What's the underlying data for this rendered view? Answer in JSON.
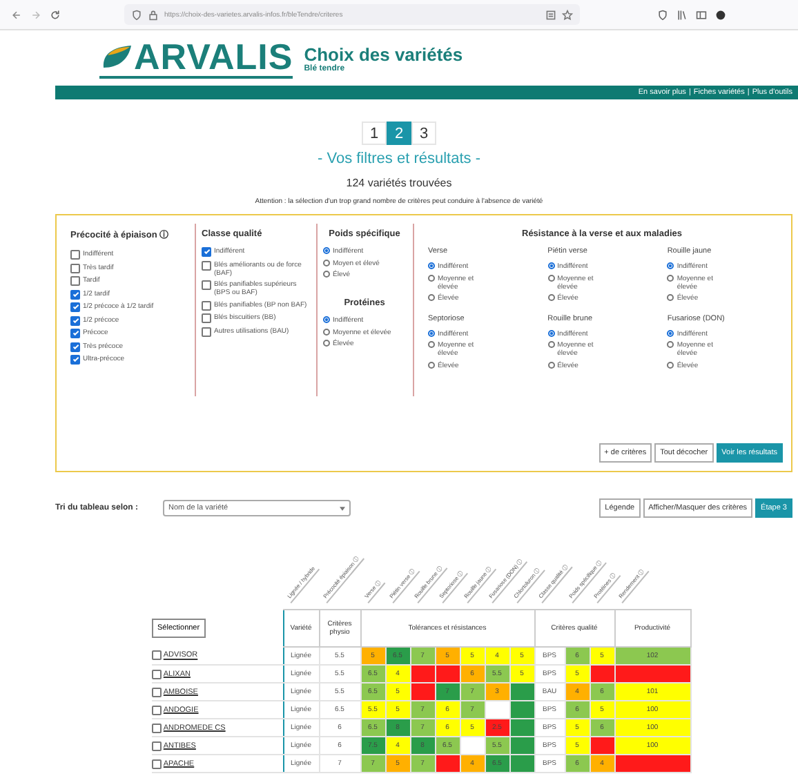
{
  "browser": {
    "url": "https://choix-des-varietes.arvalis-infos.fr/bleTendre/criteres"
  },
  "header": {
    "logo": "ARVALIS",
    "title": "Choix des variétés",
    "subtitle": "Blé tendre",
    "links": [
      "En savoir plus",
      "Fiches variétés",
      "Plus d'outils"
    ],
    "separator": "|"
  },
  "steps": [
    {
      "label": "1",
      "selected": false
    },
    {
      "label": "2",
      "selected": true
    },
    {
      "label": "3",
      "selected": false
    }
  ],
  "section_title": "- Vos filtres et résultats -",
  "count": "124 variétés trouvées",
  "warning": "Attention : la sélection d'un trop grand nombre de critères peut conduire à l'absence de variété",
  "filters": {
    "precocite": {
      "title": "Précocité à épiaison ⓘ",
      "options": [
        {
          "label": "Indifférent",
          "checked": false
        },
        {
          "label": "Très tardif",
          "checked": false
        },
        {
          "label": "Tardif",
          "checked": false
        },
        {
          "label": "1/2 tardif",
          "checked": true
        },
        {
          "label": "1/2 précoce à 1/2 tardif",
          "checked": true
        },
        {
          "label": "1/2 précoce",
          "checked": true
        },
        {
          "label": "Précoce",
          "checked": true
        },
        {
          "label": "Très précoce",
          "checked": true
        },
        {
          "label": "Ultra-précoce",
          "checked": true
        }
      ]
    },
    "classe": {
      "title": "Classe qualité",
      "options": [
        {
          "label": "Indifférent",
          "checked": true
        },
        {
          "label": "Blés améliorants ou de force (BAF)",
          "checked": false
        },
        {
          "label": "Blés panifiables supérieurs (BPS ou BAF)",
          "checked": false
        },
        {
          "label": "Blés panifiables (BP non BAF)",
          "checked": false
        },
        {
          "label": "Blés biscuitiers (BB)",
          "checked": false
        },
        {
          "label": "Autres utilisations (BAU)",
          "checked": false
        }
      ]
    },
    "poids": {
      "title": "Poids spécifique",
      "options": [
        {
          "label": "Indifférent",
          "selected": true
        },
        {
          "label": "Moyen et élevé",
          "selected": false
        },
        {
          "label": "Élevé",
          "selected": false
        }
      ]
    },
    "proteines": {
      "title": "Protéines",
      "options": [
        {
          "label": "Indifférent",
          "selected": true
        },
        {
          "label": "Moyenne et élevée",
          "selected": false
        },
        {
          "label": "Élevée",
          "selected": false
        }
      ]
    },
    "resistance": {
      "title": "Résistance à la verse et aux maladies",
      "groups": [
        {
          "title": "Verse",
          "options": [
            {
              "label": "Indifférent",
              "selected": true
            },
            {
              "label": "Moyenne et élevée",
              "selected": false
            },
            {
              "label": "Élevée",
              "selected": false
            }
          ]
        },
        {
          "title": "Piétin verse",
          "options": [
            {
              "label": "Indifférent",
              "selected": true
            },
            {
              "label": "Moyenne et élevée",
              "selected": false
            },
            {
              "label": "Élevée",
              "selected": false
            }
          ]
        },
        {
          "title": "Rouille jaune",
          "options": [
            {
              "label": "Indifférent",
              "selected": true
            },
            {
              "label": "Moyenne et élevée",
              "selected": false
            },
            {
              "label": "Élevée",
              "selected": false
            }
          ]
        },
        {
          "title": "Septoriose",
          "options": [
            {
              "label": "Indifférent",
              "selected": true
            },
            {
              "label": "Moyenne et élevée",
              "selected": false
            },
            {
              "label": "Élevée",
              "selected": false
            }
          ]
        },
        {
          "title": "Rouille brune",
          "options": [
            {
              "label": "Indifférent",
              "selected": true
            },
            {
              "label": "Moyenne et élevée",
              "selected": false
            },
            {
              "label": "Élevée",
              "selected": false
            }
          ]
        },
        {
          "title": "Fusariose (DON)",
          "options": [
            {
              "label": "Indifférent",
              "selected": true
            },
            {
              "label": "Moyenne et élevée",
              "selected": false
            },
            {
              "label": "Élevée",
              "selected": false
            }
          ]
        }
      ]
    },
    "buttons": [
      {
        "label": "+ de critères",
        "primary": false
      },
      {
        "label": "Tout décocher",
        "primary": false
      },
      {
        "label": "Voir les résultats",
        "primary": true
      }
    ]
  },
  "sort": {
    "label": "Tri du tableau selon :",
    "value": "Nom de la variété"
  },
  "table_buttons": [
    {
      "label": "Légende",
      "primary": false
    },
    {
      "label": "Afficher/Masquer des critères",
      "primary": false
    },
    {
      "label": "Étape 3",
      "primary": true
    }
  ],
  "table": {
    "select_button": "Sélectionner",
    "groups": [
      {
        "label": "Variété",
        "columns": [
          "Lignée / hybride"
        ]
      },
      {
        "label": "Critères physio",
        "columns": [
          "Précocité épiaison ⓘ"
        ]
      },
      {
        "label": "Tolérances et résistances",
        "columns": [
          "Verse ⓘ",
          "Piétin verse ⓘ",
          "Rouille brune ⓘ",
          "Septoriose ⓘ",
          "Rouille jaune ⓘ",
          "Fusariose (DON) ⓘ",
          "Chlortoluron ⓘ"
        ]
      },
      {
        "label": "Critères qualité",
        "columns": [
          "Classe qualité ⓘ",
          "Poids spécifique ⓘ",
          "Protéines ⓘ"
        ]
      },
      {
        "label": "Productivité",
        "columns": [
          "Rendement ⓘ"
        ]
      }
    ],
    "rows": [
      {
        "name": "ADVISOR",
        "checked": false,
        "type": "Lignée",
        "physio": "5.5",
        "tolerances": [
          {
            "v": "5",
            "color": "#ffb000"
          },
          {
            "v": "6.5",
            "color": "#2a9d4a"
          },
          {
            "v": "7",
            "color": "#8cc850"
          },
          {
            "v": "5",
            "color": "#ffb000"
          },
          {
            "v": "5",
            "color": "#ffff00"
          },
          {
            "v": "4",
            "color": "#ffff00"
          },
          {
            "v": "5",
            "color": "#ffff00"
          }
        ],
        "classe": "BPS",
        "quality": [
          {
            "v": "6",
            "color": "#8cc850"
          },
          {
            "v": "5",
            "color": "#ffff00"
          }
        ],
        "productivity": {
          "v": "102",
          "color": "#8cc850"
        }
      },
      {
        "name": "ALIXAN",
        "checked": false,
        "type": "Lignée",
        "physio": "5.5",
        "tolerances": [
          {
            "v": "6.5",
            "color": "#8cc850"
          },
          {
            "v": "4",
            "color": "#ffff00"
          },
          {
            "color": "#ff1a1a"
          },
          {
            "color": "#ff1a1a"
          },
          {
            "v": "6",
            "color": "#ffb000"
          },
          {
            "v": "5.5",
            "color": "#8cc850"
          },
          {
            "v": "5",
            "color": "#ffff00"
          }
        ],
        "classe": "BPS",
        "quality": [
          {
            "v": "5",
            "color": "#ffff00"
          },
          {
            "color": "#ff1a1a"
          }
        ],
        "productivity": {
          "color": "#ff1a1a"
        }
      },
      {
        "name": "AMBOISE",
        "checked": false,
        "type": "Lignée",
        "physio": "5.5",
        "tolerances": [
          {
            "v": "6.5",
            "color": "#8cc850"
          },
          {
            "v": "5",
            "color": "#ffff00"
          },
          {
            "color": "#ff1a1a"
          },
          {
            "v": "7",
            "color": "#2a9d4a"
          },
          {
            "v": "7",
            "color": "#8cc850"
          },
          {
            "v": "3",
            "color": "#ffb000"
          },
          {
            "color": "#2a9d4a"
          }
        ],
        "classe": "BAU",
        "quality": [
          {
            "v": "4",
            "color": "#ffb000"
          },
          {
            "v": "6",
            "color": "#8cc850"
          }
        ],
        "productivity": {
          "v": "101",
          "color": "#ffff00"
        }
      },
      {
        "name": "ANDOGIE",
        "checked": false,
        "type": "Lignée",
        "physio": "6.5",
        "tolerances": [
          {
            "v": "5.5",
            "color": "#ffff00"
          },
          {
            "v": "5",
            "color": "#ffff00"
          },
          {
            "v": "7",
            "color": "#8cc850"
          },
          {
            "v": "6",
            "color": "#ffff00"
          },
          {
            "v": "7",
            "color": "#8cc850"
          },
          {
            "color": "#ffffff"
          },
          {
            "color": "#2a9d4a"
          }
        ],
        "classe": "BPS",
        "quality": [
          {
            "v": "6",
            "color": "#8cc850"
          },
          {
            "v": "5",
            "color": "#ffff00"
          }
        ],
        "productivity": {
          "v": "100",
          "color": "#ffff00"
        }
      },
      {
        "name": "ANDROMEDE CS",
        "checked": false,
        "type": "Lignée",
        "physio": "6",
        "tolerances": [
          {
            "v": "6.5",
            "color": "#8cc850"
          },
          {
            "v": "8",
            "color": "#2a9d4a"
          },
          {
            "v": "7",
            "color": "#8cc850"
          },
          {
            "v": "6",
            "color": "#ffff00"
          },
          {
            "v": "5",
            "color": "#ffff00"
          },
          {
            "v": "2.5",
            "color": "#ff1a1a"
          },
          {
            "color": "#2a9d4a"
          }
        ],
        "classe": "BPS",
        "quality": [
          {
            "v": "5",
            "color": "#ffff00"
          },
          {
            "v": "6",
            "color": "#8cc850"
          }
        ],
        "productivity": {
          "v": "100",
          "color": "#ffff00"
        }
      },
      {
        "name": "ANTIBES",
        "checked": false,
        "type": "Lignée",
        "physio": "6",
        "tolerances": [
          {
            "v": "7.5",
            "color": "#2a9d4a"
          },
          {
            "v": "4",
            "color": "#ffff00"
          },
          {
            "v": "8",
            "color": "#2a9d4a"
          },
          {
            "v": "6.5",
            "color": "#8cc850"
          },
          {
            "color": "#ffffff"
          },
          {
            "v": "5.5",
            "color": "#8cc850"
          },
          {
            "color": "#2a9d4a"
          }
        ],
        "classe": "BPS",
        "quality": [
          {
            "v": "5",
            "color": "#ffff00"
          },
          {
            "color": "#ff1a1a"
          }
        ],
        "productivity": {
          "v": "100",
          "color": "#ffff00"
        }
      },
      {
        "name": "APACHE",
        "checked": false,
        "type": "Lignée",
        "physio": "7",
        "tolerances": [
          {
            "v": "7",
            "color": "#8cc850"
          },
          {
            "v": "5",
            "color": "#ffb000"
          },
          {
            "v": "7",
            "color": "#8cc850"
          },
          {
            "color": "#ff1a1a"
          },
          {
            "v": "4",
            "color": "#ffb000"
          },
          {
            "v": "6.5",
            "color": "#2a9d4a"
          },
          {
            "color": "#2a9d4a"
          }
        ],
        "classe": "BPS",
        "quality": [
          {
            "v": "6",
            "color": "#8cc850"
          },
          {
            "v": "4",
            "color": "#ffb000"
          }
        ],
        "productivity": {
          "color": "#ff1a1a"
        }
      }
    ]
  }
}
